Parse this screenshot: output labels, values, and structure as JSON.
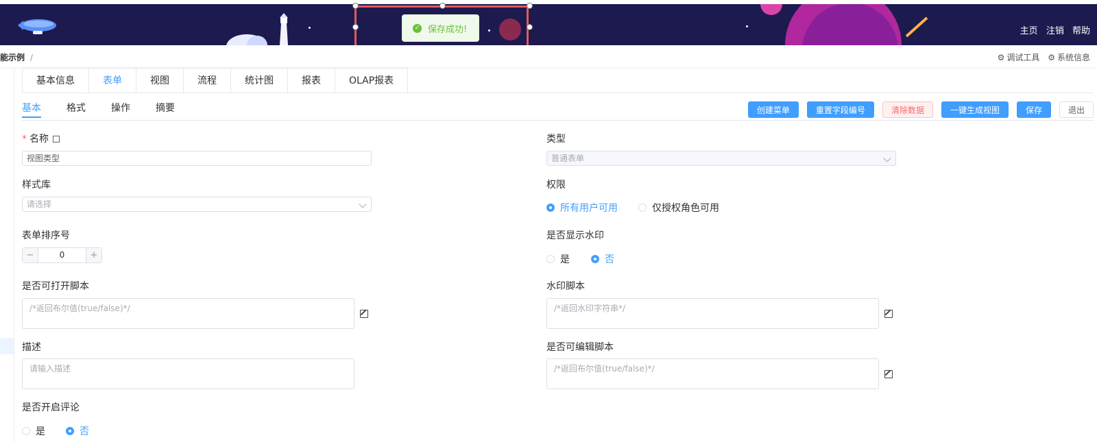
{
  "header": {
    "nav": [
      "主页",
      "注销",
      "帮助"
    ],
    "colors": {
      "header_bg": "#1d1a4f",
      "accent": "#409eff",
      "success": "#67c23a",
      "danger": "#f56c6c"
    }
  },
  "breadcrumb": {
    "current": "能示例",
    "sep": "/"
  },
  "tools": {
    "debug": "调试工具",
    "sysinfo": "系统信息"
  },
  "tabs_main": [
    "基本信息",
    "表单",
    "视图",
    "流程",
    "统计图",
    "报表",
    "OLAP报表"
  ],
  "tabs_main_active": "表单",
  "tabs_sub": [
    "基本",
    "格式",
    "操作",
    "摘要"
  ],
  "tabs_sub_active": "基本",
  "actions": [
    "创建菜单",
    "重置字段编号",
    "清除数据",
    "一键生成视图",
    "保存",
    "退出"
  ],
  "form": {
    "name_label": "名称",
    "name_value": "视图类型",
    "type_label": "类型",
    "type_value": "普通表单",
    "style_label": "样式库",
    "style_placeholder": "请选择",
    "perm_label": "权限",
    "perm_opt1": "所有用户可用",
    "perm_opt2": "仅授权角色可用",
    "sort_label": "表单排序号",
    "sort_value": "0",
    "watermark_label": "是否显示水印",
    "yes": "是",
    "no": "否",
    "open_script_label": "是否可打开脚本",
    "open_script_ph": "/*返回布尔值(true/false)*/",
    "wm_script_label": "水印脚本",
    "wm_script_ph": "/*返回水印字符串*/",
    "desc_label": "描述",
    "desc_ph": "请输入描述",
    "edit_script_label": "是否可编辑脚本",
    "edit_script_ph": "/*返回布尔值(true/false)*/",
    "comment_label": "是否开启评论"
  },
  "toast": {
    "text": "保存成功!"
  }
}
